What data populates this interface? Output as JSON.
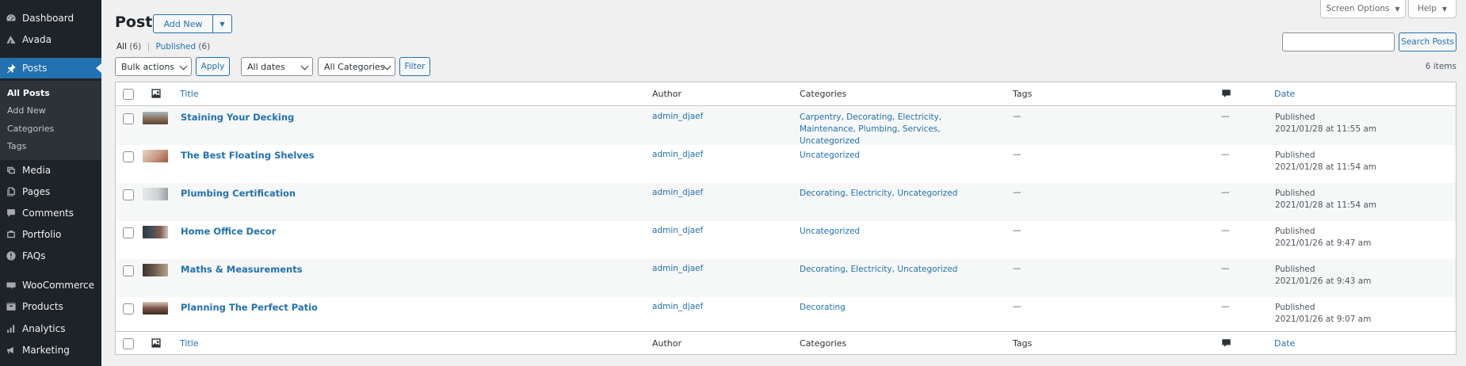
{
  "sidebar": {
    "items": [
      {
        "label": "Dashboard",
        "icon": "dashboard-icon"
      },
      {
        "label": "Avada",
        "icon": "avada-icon"
      },
      {
        "label": "Posts",
        "icon": "pin-icon",
        "current": true
      },
      {
        "label": "Media",
        "icon": "media-icon"
      },
      {
        "label": "Pages",
        "icon": "pages-icon"
      },
      {
        "label": "Comments",
        "icon": "comments-icon"
      },
      {
        "label": "Portfolio",
        "icon": "portfolio-icon"
      },
      {
        "label": "FAQs",
        "icon": "faq-icon"
      },
      {
        "label": "WooCommerce",
        "icon": "woocommerce-icon"
      },
      {
        "label": "Products",
        "icon": "products-icon"
      },
      {
        "label": "Analytics",
        "icon": "analytics-icon"
      },
      {
        "label": "Marketing",
        "icon": "marketing-icon"
      }
    ],
    "submenu": [
      "All Posts",
      "Add New",
      "Categories",
      "Tags"
    ]
  },
  "header": {
    "title": "Posts",
    "add_new_label": "Add New",
    "screen_options_label": "Screen Options",
    "help_label": "Help"
  },
  "filters": {
    "all_label": "All",
    "all_count": "(6)",
    "published_label": "Published",
    "published_count": "(6)",
    "search_value": "",
    "search_button": "Search Posts",
    "bulk_actions": "Bulk actions",
    "apply_label": "Apply",
    "dates": "All dates",
    "categories": "All Categories",
    "filter_label": "Filter",
    "items_count": "6 items"
  },
  "table": {
    "columns": {
      "title": "Title",
      "author": "Author",
      "categories": "Categories",
      "tags": "Tags",
      "date": "Date"
    },
    "rows": [
      {
        "title": "Staining Your Decking",
        "author": "admin_djaef",
        "categories": "Carpentry, Decorating, Electricity, Maintenance, Plumbing, Services, Uncategorized",
        "tags": "—",
        "comments": "—",
        "status": "Published",
        "date": "2021/01/28 at 11:55 am",
        "thumb": "#8a6f55"
      },
      {
        "title": "The Best Floating Shelves",
        "author": "admin_djaef",
        "categories": "Uncategorized",
        "tags": "—",
        "comments": "—",
        "status": "Published",
        "date": "2021/01/28 at 11:54 am",
        "thumb": "#c9a08a"
      },
      {
        "title": "Plumbing Certification",
        "author": "admin_djaef",
        "categories": "Decorating, Electricity, Uncategorized",
        "tags": "—",
        "comments": "—",
        "status": "Published",
        "date": "2021/01/28 at 11:54 am",
        "thumb": "#cfd2d4"
      },
      {
        "title": "Home Office Decor",
        "author": "admin_djaef",
        "categories": "Uncategorized",
        "tags": "—",
        "comments": "—",
        "status": "Published",
        "date": "2021/01/26 at 9:47 am",
        "thumb": "#4a4f5e"
      },
      {
        "title": "Maths & Measurements",
        "author": "admin_djaef",
        "categories": "Decorating, Electricity, Uncategorized",
        "tags": "—",
        "comments": "—",
        "status": "Published",
        "date": "2021/01/26 at 9:43 am",
        "thumb": "#6b5a4a"
      },
      {
        "title": "Planning The Perfect Patio",
        "author": "admin_djaef",
        "categories": "Decorating",
        "tags": "—",
        "comments": "—",
        "status": "Published",
        "date": "2021/01/26 at 9:07 am",
        "thumb": "#7a5544"
      }
    ]
  }
}
